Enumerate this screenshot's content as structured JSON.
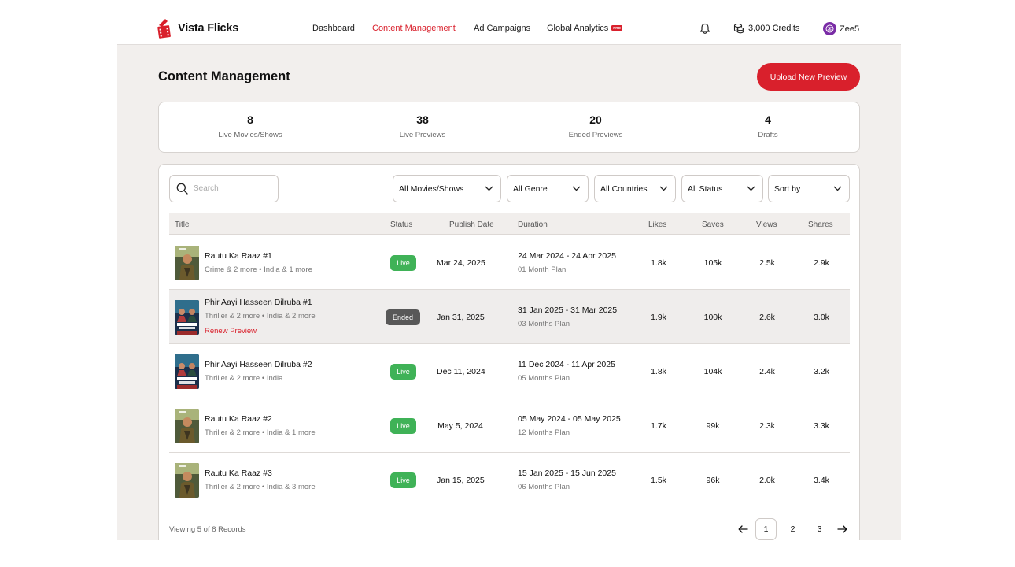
{
  "brand": {
    "name": "Vista Flicks",
    "accent": "#d9202c"
  },
  "nav": {
    "items": [
      {
        "label": "Dashboard",
        "active": false
      },
      {
        "label": "Content Management",
        "active": true
      },
      {
        "label": "Ad Campaigns",
        "active": false
      },
      {
        "label": "Global Analytics",
        "active": false,
        "badge": "PRO"
      }
    ]
  },
  "header": {
    "bell_icon": "bell-icon",
    "credits": "3,000 Credits",
    "account_name": "Zee5"
  },
  "page": {
    "title": "Content Management",
    "upload_button": "Upload New Preview"
  },
  "stats": [
    {
      "value": "8",
      "label": "Live Movies/Shows"
    },
    {
      "value": "38",
      "label": "Live Previews"
    },
    {
      "value": "20",
      "label": "Ended Previews"
    },
    {
      "value": "4",
      "label": "Drafts"
    }
  ],
  "search": {
    "placeholder": "Search",
    "value": ""
  },
  "filters": [
    {
      "label": "All Movies/Shows"
    },
    {
      "label": "All Genre"
    },
    {
      "label": "All Countries"
    },
    {
      "label": "All Status"
    },
    {
      "label": "Sort by"
    }
  ],
  "table": {
    "columns": [
      "Title",
      "Status",
      "Publish Date",
      "Duration",
      "Likes",
      "Saves",
      "Views",
      "Shares"
    ],
    "rows": [
      {
        "title": "Rautu Ka Raaz #1",
        "meta": "Crime & 2 more • India & 1 more",
        "renew": "",
        "status": "Live",
        "publish": "Mar 24, 2025",
        "duration": "24 Mar 2024 - 24 Apr 2025",
        "plan": "01 Month Plan",
        "likes": "1.8k",
        "saves": "105k",
        "views": "2.5k",
        "shares": "2.9k",
        "poster": "rautu"
      },
      {
        "title": "Phir Aayi Hasseen Dilruba #1",
        "meta": "Thriller & 2 more • India & 2 more",
        "renew": "Renew Preview",
        "status": "Ended",
        "publish": "Jan 31, 2025",
        "duration": "31 Jan 2025 - 31 Mar 2025",
        "plan": "03 Months Plan",
        "likes": "1.9k",
        "saves": "100k",
        "views": "2.6k",
        "shares": "3.0k",
        "poster": "dilruba"
      },
      {
        "title": "Phir Aayi Hasseen Dilruba #2",
        "meta": "Thriller & 2 more • India",
        "renew": "",
        "status": "Live",
        "publish": "Dec 11, 2024",
        "duration": "11 Dec 2024 - 11 Apr 2025",
        "plan": "05 Months Plan",
        "likes": "1.8k",
        "saves": "104k",
        "views": "2.4k",
        "shares": "3.2k",
        "poster": "dilruba"
      },
      {
        "title": "Rautu Ka Raaz #2",
        "meta": "Thriller & 2 more • India & 1 more",
        "renew": "",
        "status": "Live",
        "publish": "May 5, 2024",
        "duration": "05 May 2024 - 05 May 2025",
        "plan": "12 Months Plan",
        "likes": "1.7k",
        "saves": "99k",
        "views": "2.3k",
        "shares": "3.3k",
        "poster": "rautu"
      },
      {
        "title": "Rautu Ka Raaz #3",
        "meta": "Thriller & 2 more • India & 3 more",
        "renew": "",
        "status": "Live",
        "publish": "Jan 15, 2025",
        "duration": "15 Jan 2025 - 15 Jun 2025",
        "plan": "06 Months Plan",
        "likes": "1.5k",
        "saves": "96k",
        "views": "2.0k",
        "shares": "3.4k",
        "poster": "rautu"
      }
    ]
  },
  "footer": {
    "viewing": "Viewing 5 of 8 Records",
    "pages": [
      "1",
      "2",
      "3"
    ],
    "current_page": "1"
  },
  "colors": {
    "live": "#3fb257",
    "ended": "#585858",
    "background": "#f2efed"
  }
}
